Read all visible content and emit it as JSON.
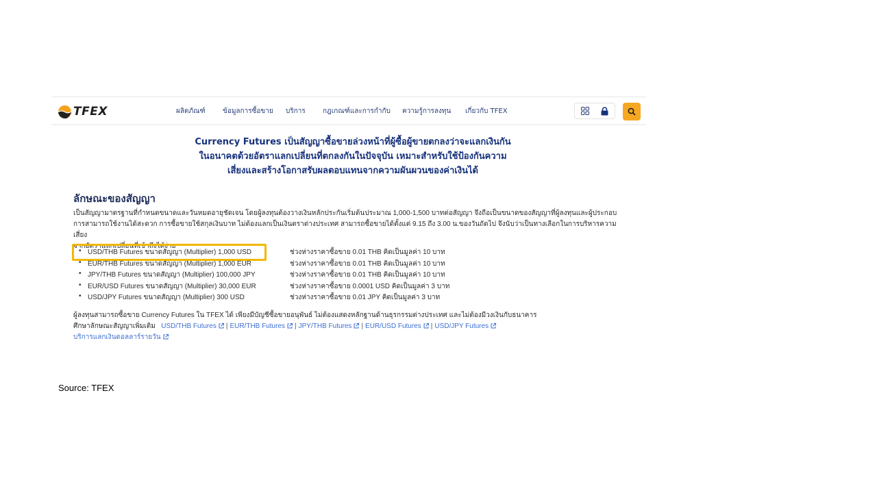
{
  "navbar": {
    "logo_text": "TFEX",
    "menu": [
      "ผลิตภัณฑ์",
      "ข้อมูลการซื้อขาย",
      "บริการ",
      "กฎเกณฑ์และการกำกับ",
      "ความรู้การลงทุน",
      "เกี่ยวกับ TFEX"
    ],
    "icons": [
      "grid-icon",
      "lock-icon",
      "search-icon"
    ],
    "accent_color": "#f6a822",
    "menu_color": "#2a3f7a"
  },
  "hero": {
    "lines": [
      "Currency Futures เป็นสัญญาซื้อขายล่วงหน้าที่ผู้ซื้อผู้ขายตกลงว่าจะแลกเงินกัน",
      "ในอนาคตด้วยอัตราแลกเปลี่ยนที่ตกลงกันในปัจจุบัน เหมาะสำหรับใช้ป้องกันความ",
      "เสี่ยงและสร้างโอกาสรับผลตอบแทนจากความผันผวนของค่าเงินได้"
    ],
    "color": "#17327c"
  },
  "section": {
    "title": "ลักษณะของสัญญา",
    "intro_lines": [
      "เป็นสัญญามาตรฐานที่กำหนดขนาดและวันหมดอายุชัดเจน โดยผู้ลงทุนต้องวางเงินหลักประกันเริ่มต้นประมาณ 1,000-1,500 บาทต่อสัญญา จึงถือเป็นขนาดของสัญญาที่ผู้ลงทุนและผู้ประกอบ",
      "การสามารถใช้งานได้สะดวก การซื้อขายใช้สกุลเงินบาท ไม่ต้องแลกเป็นเงินตราต่างประเทศ สามารถซื้อขายได้ตั้งแต่ 9.15 ถึง 3.00 น.ของวันถัดไป จึงนับว่าเป็นทางเลือกในการบริหารความเสี่ยง",
      "จากอัตราแลกเปลี่ยนที่เข้าถึงได้ง่าย"
    ],
    "specs": [
      {
        "name": "USD/THB Futures ขนาดสัญญา (Multiplier) 1,000 USD",
        "tick": "ช่วงห่างราคาซื้อขาย 0.01 THB คิดเป็นมูลค่า 10 บาท"
      },
      {
        "name": "EUR/THB Futures ขนาดสัญญา (Multiplier) 1,000 EUR",
        "tick": "ช่วงห่างราคาซื้อขาย 0.01 THB คิดเป็นมูลค่า 10 บาท"
      },
      {
        "name": "JPY/THB Futures ขนาดสัญญา (Multiplier) 100,000 JPY",
        "tick": "ช่วงห่างราคาซื้อขาย 0.01 THB คิดเป็นมูลค่า 10 บาท"
      },
      {
        "name": "EUR/USD Futures ขนาดสัญญา (Multiplier) 30,000 EUR",
        "tick": "ช่วงห่างราคาซื้อขาย 0.0001 USD คิดเป็นมูลค่า 3 บาท"
      },
      {
        "name": "USD/JPY Futures ขนาดสัญญา (Multiplier) 300 USD",
        "tick": "ช่วงห่างราคาซื้อขาย 0.01 JPY คิดเป็นมูลค่า 3 บาท"
      }
    ],
    "highlight_color": "#f2b800",
    "footer_line": "ผู้ลงทุนสามารถซื้อขาย Currency Futures ใน TFEX ได้ เพียงมีบัญชีซื้อขายอนุพันธ์ ไม่ต้องแสดงหลักฐานด้านธุรกรรมต่างประเทศ และไม่ต้องมีวงเงินกับธนาคาร",
    "links_prefix": "ศึกษาลักษณะสัญญาเพิ่มเติม",
    "links": [
      "USD/THB Futures",
      "EUR/THB Futures",
      "JPY/THB Futures",
      "EUR/USD Futures",
      "USD/JPY Futures"
    ],
    "extra_link": "บริการแลกเงินดอลลาร์รายวัน",
    "link_color": "#3d6fd1"
  },
  "source": "Source: TFEX"
}
